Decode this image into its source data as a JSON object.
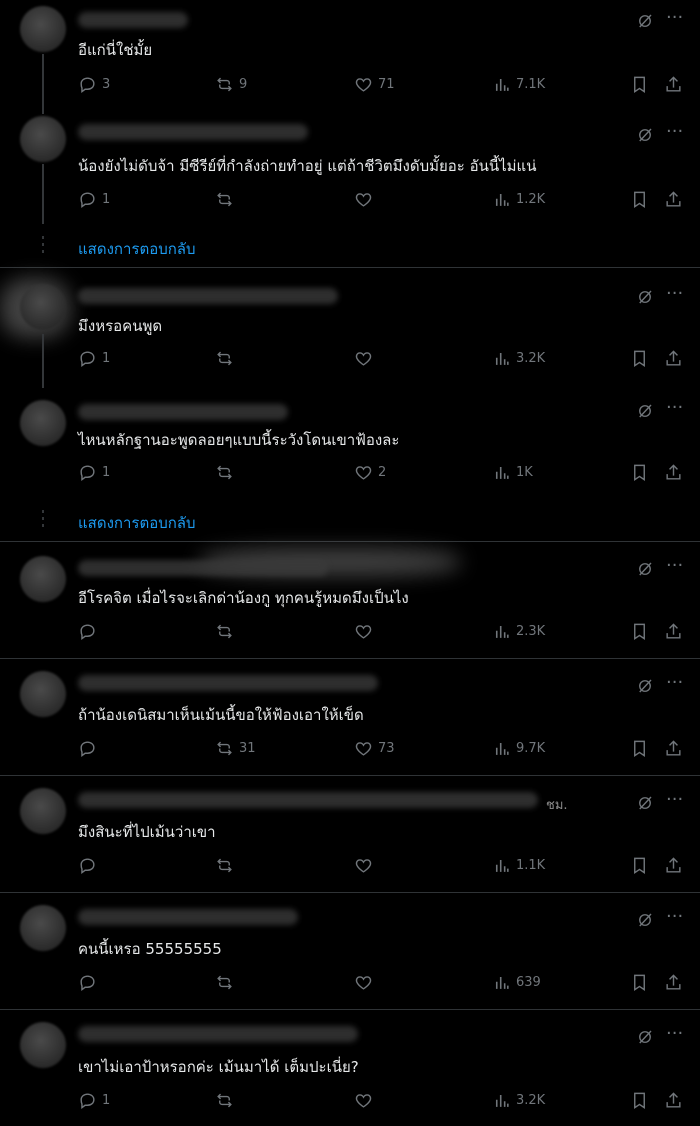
{
  "posts": [
    {
      "text": "อีแก่นี่ใช่มั้ย",
      "replies": "3",
      "reposts": "9",
      "likes": "71",
      "views": "7.1K"
    },
    {
      "text": "น้องยังไม่ดับจ้า มีซีรีย์ที่กำลังถ่ายทำอยู่ แต่ถ้าชีวิตมึงดับมั้ยอะ อันนี้ไม่แน่",
      "replies": "1",
      "reposts": "",
      "likes": "",
      "views": "1.2K"
    },
    {
      "text": "มึงหรอคนพูด",
      "replies": "1",
      "reposts": "",
      "likes": "",
      "views": "3.2K"
    },
    {
      "text": "ไหนหลักฐานอะพูดลอยๆแบบนี้ระวังโดนเขาฟ้องละ",
      "replies": "1",
      "reposts": "",
      "likes": "2",
      "views": "1K"
    },
    {
      "text": "อีโรคจิต เมื่อไรจะเลิกด่าน้องกู ทุกคนรู้หมดมึงเป็นไง",
      "replies": "",
      "reposts": "",
      "likes": "",
      "views": "2.3K"
    },
    {
      "text": "ถ้าน้องเดนิสมาเห็นเม้นนี้ขอให้ฟ้องเอาให้เข็ด",
      "replies": "",
      "reposts": "31",
      "likes": "73",
      "views": "9.7K"
    },
    {
      "text": "มึงสินะที่ไปเม้นว่าเขา",
      "replies": "",
      "reposts": "",
      "likes": "",
      "views": "1.1K",
      "handle_tail": "ชม."
    },
    {
      "text": "คนนี้เหรอ 55555555",
      "replies": "",
      "reposts": "",
      "likes": "",
      "views": "639"
    },
    {
      "text": "เขาไม่เอาป้าหรอกค่ะ  เม้นมาได้ เต็มปะเนี่ย?",
      "replies": "1",
      "reposts": "",
      "likes": "",
      "views": "3.2K"
    }
  ],
  "show_replies_label": "แสดงการตอบกลับ",
  "icons": {
    "reply": "reply-icon",
    "repost": "repost-icon",
    "like": "heart-icon",
    "views": "views-icon",
    "bookmark": "bookmark-icon",
    "share": "share-icon",
    "grok": "grok-icon",
    "more": "more-icon"
  },
  "colors": {
    "background": "#000000",
    "text": "#e7e9ea",
    "muted": "#71767b",
    "link": "#1d9bf0",
    "divider": "#2f3336"
  }
}
